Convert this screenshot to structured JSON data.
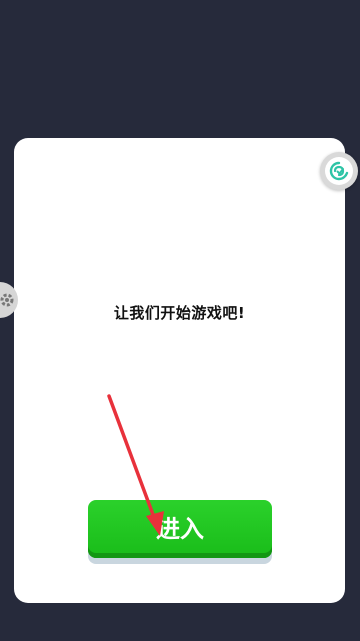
{
  "dialog": {
    "message": "让我们开始游戏吧!",
    "enter_label": "进入"
  },
  "floating_buttons": {
    "right_icon": "game-assistant-icon",
    "left_icon": "settings-gear-icon"
  },
  "colors": {
    "background": "#262a3b",
    "card": "#ffffff",
    "button": "#1fc41f",
    "annotation_arrow": "#e8313b"
  }
}
